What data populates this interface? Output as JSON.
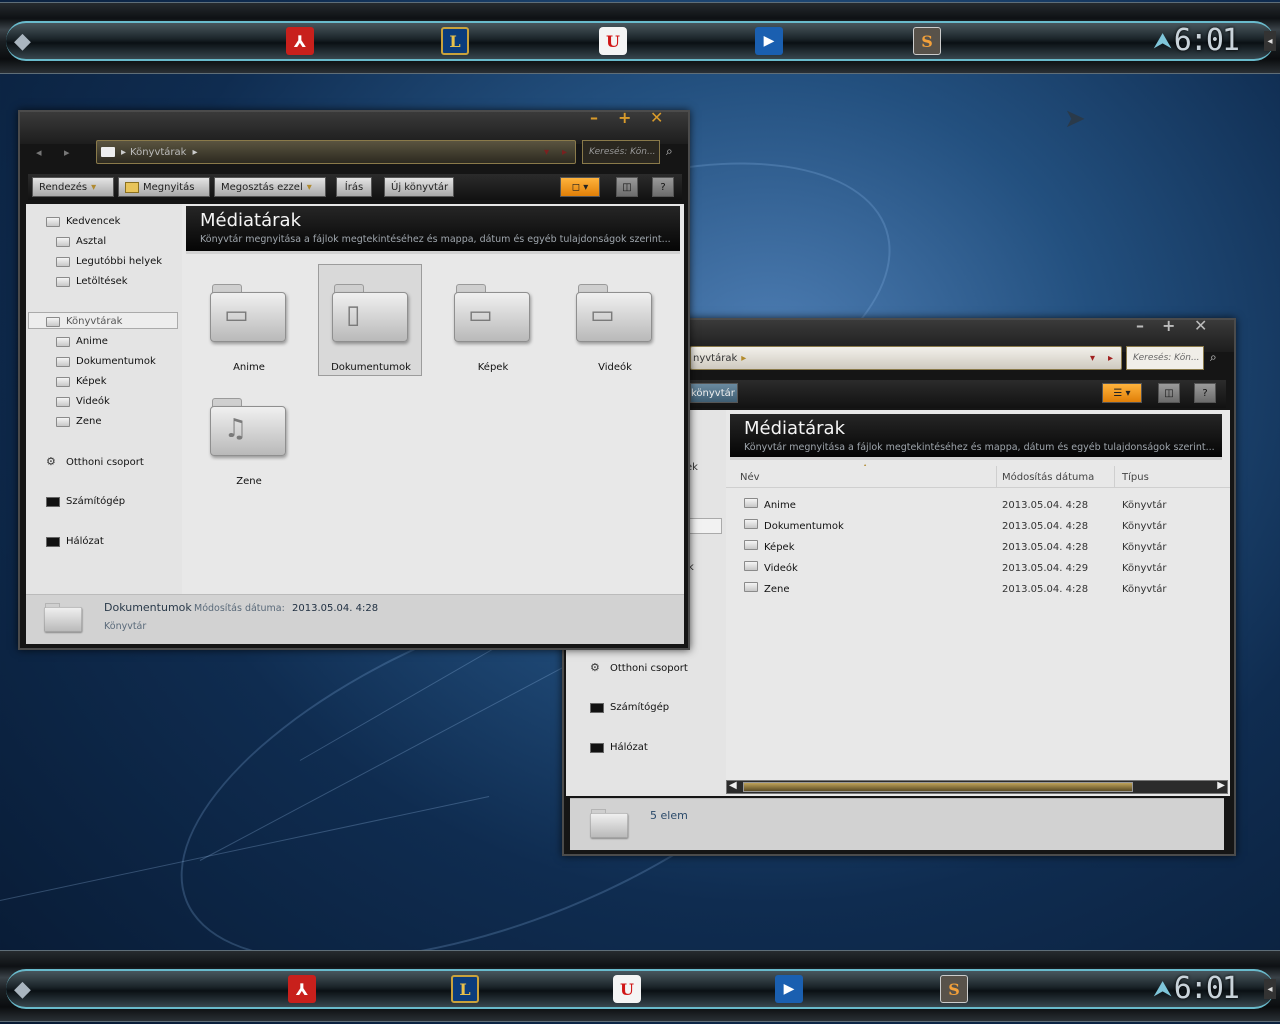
{
  "taskbar": {
    "clock": "6:01",
    "icons": [
      "pdf-icon",
      "league-of-legends-icon",
      "red-app-icon",
      "media-player-icon",
      "sublime-text-icon"
    ],
    "pdf_glyph": "⅄",
    "lol_glyph": "L",
    "red_glyph": "U",
    "play_glyph": "▶",
    "sub_glyph": "S"
  },
  "window1": {
    "minimize": "–",
    "maximize": "+",
    "close": "✕",
    "back": "◂",
    "forward": "▸",
    "breadcrumb": "Könyvtárak",
    "search_placeholder": "Keresés: Kön...",
    "toolbar": {
      "organize": "Rendezés",
      "open": "Megnyitás",
      "share": "Megosztás ezzel",
      "burn": "Írás",
      "new_library": "Új könyvtár",
      "help": "?"
    },
    "nav": {
      "favorites": "Kedvencek",
      "desktop": "Asztal",
      "recent": "Legutóbbi helyek",
      "downloads": "Letöltések",
      "libraries": "Könyvtárak",
      "anime": "Anime",
      "documents": "Dokumentumok",
      "pictures": "Képek",
      "videos": "Videók",
      "music": "Zene",
      "homegroup": "Otthoni csoport",
      "computer": "Számítógép",
      "network": "Hálózat"
    },
    "header": {
      "title": "Médiatárak",
      "subtitle": "Könyvtár megnyitása a fájlok megtekintéséhez és mappa, dátum és egyéb tulajdonságok szerint..."
    },
    "folders": [
      "Anime",
      "Dokumentumok",
      "Képek",
      "Videók",
      "Zene"
    ],
    "details": {
      "name": "Dokumentumok",
      "date_label": "Módosítás dátuma:",
      "date_value": "2013.05.04. 4:28",
      "type": "Könyvtár"
    }
  },
  "window2": {
    "minimize": "–",
    "maximize": "+",
    "close": "✕",
    "breadcrumb": "nyvtárak",
    "search_placeholder": "Keresés: Kön...",
    "toolbar_partial": "könyvtár",
    "help": "?",
    "header": {
      "title": "Médiatárak",
      "subtitle": "Könyvtár megnyitása a fájlok megtekintéséhez és mappa, dátum és egyéb tulajdonságok szerint..."
    },
    "columns": {
      "name": "Név",
      "date": "Módosítás dátuma",
      "type": "Típus"
    },
    "rows": [
      {
        "name": "Anime",
        "date": "2013.05.04. 4:28",
        "type": "Könyvtár"
      },
      {
        "name": "Dokumentumok",
        "date": "2013.05.04. 4:28",
        "type": "Könyvtár"
      },
      {
        "name": "Képek",
        "date": "2013.05.04. 4:28",
        "type": "Könyvtár"
      },
      {
        "name": "Videók",
        "date": "2013.05.04. 4:29",
        "type": "Könyvtár"
      },
      {
        "name": "Zene",
        "date": "2013.05.04. 4:28",
        "type": "Könyvtár"
      }
    ],
    "nav_fragments": [
      "ek",
      "k"
    ],
    "nav": {
      "homegroup": "Otthoni csoport",
      "computer": "Számítógép",
      "network": "Hálózat"
    },
    "status": "5 elem"
  }
}
